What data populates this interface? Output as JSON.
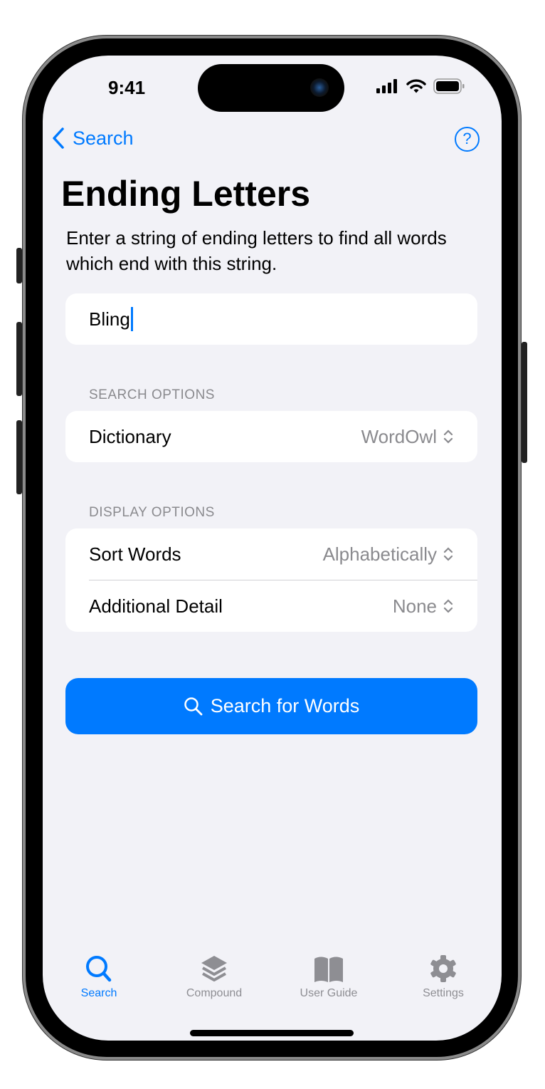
{
  "status": {
    "time": "9:41"
  },
  "nav": {
    "back_label": "Search",
    "help_icon": "question-circle-icon"
  },
  "page": {
    "title": "Ending Letters",
    "description": "Enter a string of ending letters to find all words which end with this string."
  },
  "input": {
    "value": "Bling"
  },
  "search_options": {
    "header": "SEARCH OPTIONS",
    "dictionary_label": "Dictionary",
    "dictionary_value": "WordOwl"
  },
  "display_options": {
    "header": "DISPLAY OPTIONS",
    "sort_label": "Sort Words",
    "sort_value": "Alphabetically",
    "detail_label": "Additional Detail",
    "detail_value": "None"
  },
  "action": {
    "label": "Search for Words"
  },
  "tabs": [
    {
      "label": "Search",
      "icon": "search-icon",
      "active": true
    },
    {
      "label": "Compound",
      "icon": "layers-icon"
    },
    {
      "label": "User Guide",
      "icon": "book-icon"
    },
    {
      "label": "Settings",
      "icon": "gear-icon"
    }
  ],
  "colors": {
    "accent": "#007aff",
    "background": "#f2f2f7",
    "inactive": "#8e8e93"
  }
}
